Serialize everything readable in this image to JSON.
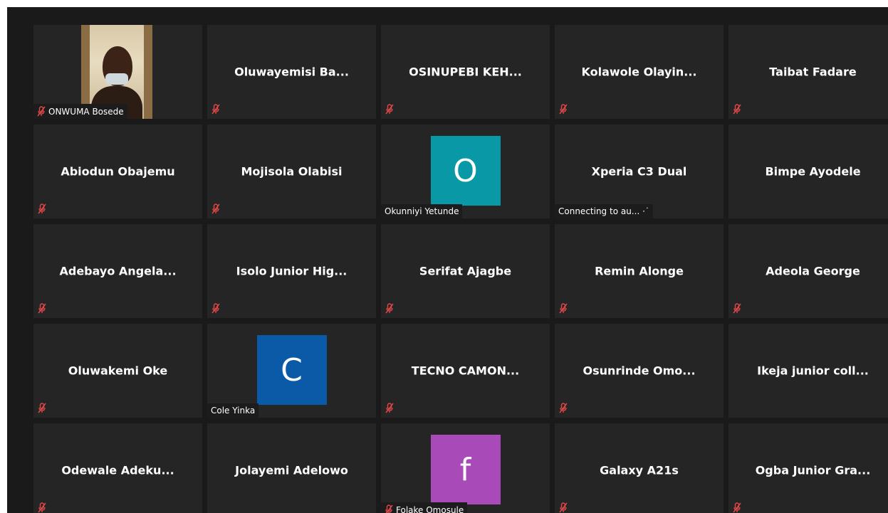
{
  "colors": {
    "stage": "#1a1a1a",
    "tile": "#252525",
    "mute_icon": "#e04848"
  },
  "participants": [
    {
      "name": "ONWUMA Bosede",
      "type": "video",
      "muted": true
    },
    {
      "name": "Oluwayemisi  Ba...",
      "type": "name",
      "muted": true
    },
    {
      "name": "OSINUPEBI  KEH...",
      "type": "name",
      "muted": true
    },
    {
      "name": "Kolawole  Olayin...",
      "type": "name",
      "muted": true
    },
    {
      "name": "Taibat Fadare",
      "type": "name",
      "muted": true
    },
    {
      "name": "Abiodun Obajemu",
      "type": "name",
      "muted": true
    },
    {
      "name": "Mojisola Olabisi",
      "type": "name",
      "muted": true
    },
    {
      "name": "Okunniyi Yetunde",
      "type": "avatar",
      "initial": "O",
      "color": "#0898a6",
      "muted": false
    },
    {
      "name": "Xperia C3 Dual",
      "type": "name",
      "muted": false,
      "status": "Connecting to au... ·˙"
    },
    {
      "name": "Bimpe Ayodele",
      "type": "name",
      "muted": false
    },
    {
      "name": "Adebayo  Angela...",
      "type": "name",
      "muted": true
    },
    {
      "name": "Isolo  Junior  Hig...",
      "type": "name",
      "muted": true
    },
    {
      "name": "Serifat Ajagbe",
      "type": "name",
      "muted": true
    },
    {
      "name": "Remin Alonge",
      "type": "name",
      "muted": true
    },
    {
      "name": "Adeola George",
      "type": "name",
      "muted": true
    },
    {
      "name": "Oluwakemi Oke",
      "type": "name",
      "muted": true
    },
    {
      "name": "Cole Yinka",
      "type": "avatar",
      "initial": "C",
      "color": "#0b5aa8",
      "muted": false
    },
    {
      "name": "TECNO  CAMON...",
      "type": "name",
      "muted": true
    },
    {
      "name": "Osunrinde  Omo...",
      "type": "name",
      "muted": true
    },
    {
      "name": "Ikeja junior coll...",
      "type": "name",
      "muted": false
    },
    {
      "name": "Odewale  Adeku...",
      "type": "name",
      "muted": true
    },
    {
      "name": "Jolayemi Adelowo",
      "type": "name",
      "muted": false
    },
    {
      "name": "Folake Omosule",
      "type": "avatar",
      "initial": "f",
      "color": "#a84ab8",
      "muted": true
    },
    {
      "name": "Galaxy A21s",
      "type": "name",
      "muted": true
    },
    {
      "name": "Ogba  Junior  Gra...",
      "type": "name",
      "muted": true
    }
  ]
}
